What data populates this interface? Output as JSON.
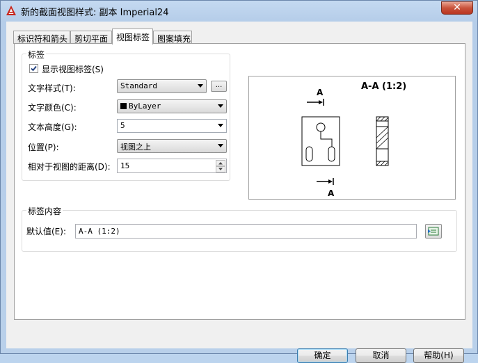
{
  "window": {
    "title": "新的截面视图样式: 副本 Imperial24",
    "close_glyph": "✕"
  },
  "tabs": [
    {
      "label": "标识符和箭头",
      "active": false
    },
    {
      "label": "剪切平面",
      "active": false
    },
    {
      "label": "视图标签",
      "active": true
    },
    {
      "label": "图案填充",
      "active": false
    }
  ],
  "label_group": {
    "title": "标签",
    "show_label": {
      "label": "显示视图标签(S)",
      "checked": true
    },
    "text_style": {
      "label": "文字样式(T):",
      "value": "Standard",
      "browse_label": "..."
    },
    "text_color": {
      "label": "文字颜色(C):",
      "value": "ByLayer",
      "swatch_color": "#000000"
    },
    "text_height": {
      "label": "文本高度(G):",
      "value": "5"
    },
    "position": {
      "label": "位置(P):",
      "value": "视图之上"
    },
    "distance": {
      "label": "相对于视图的距离(D):",
      "value": "15"
    }
  },
  "preview": {
    "title_text": "A-A (1:2)",
    "top_marker": "A",
    "bottom_marker": "A"
  },
  "content_group": {
    "title": "标签内容",
    "default_label": "默认值(E):",
    "default_value": "A-A (1:2)"
  },
  "buttons": {
    "ok": "确定",
    "cancel": "取消",
    "help": "帮助(H)"
  }
}
